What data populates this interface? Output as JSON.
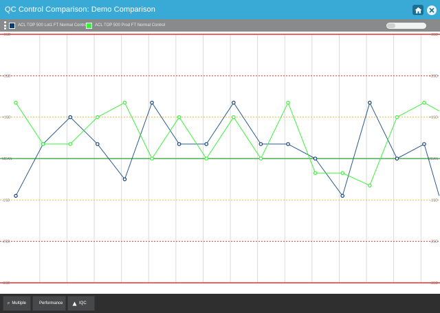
{
  "window": {
    "title": "QC Control Comparison: Demo Comparison",
    "home_icon": "home-icon",
    "close_icon": "close-icon"
  },
  "legend": {
    "items": [
      {
        "label": "ACL TOP 500 Lot1 FT Normal Control",
        "color": "#0d3b73"
      },
      {
        "label": "ACL TOP 500 Prod FT Normal Control",
        "color": "#3cf23c"
      }
    ],
    "toggle_icon": "toggle-switch-icon"
  },
  "chart_data": {
    "type": "line",
    "y_levels": [
      {
        "label": "+3SD",
        "value": 3,
        "color": "#e8322b",
        "style": "solid"
      },
      {
        "label": "+2SD",
        "value": 2,
        "color": "#e8322b",
        "style": "dotted"
      },
      {
        "label": "+1SD",
        "value": 1,
        "color": "#f0c040",
        "style": "dotted"
      },
      {
        "label": "MEAN",
        "value": 0,
        "color": "#4caf50",
        "style": "solid"
      },
      {
        "label": "-1SD",
        "value": -1,
        "color": "#f0c040",
        "style": "dotted"
      },
      {
        "label": "-2SD",
        "value": -2,
        "color": "#e8322b",
        "style": "dotted"
      },
      {
        "label": "-3SD",
        "value": -3,
        "color": "#e8322b",
        "style": "solid"
      }
    ],
    "ylim": [
      -3,
      3
    ],
    "x_count": 16,
    "grid_vertical": true,
    "series": [
      {
        "color": "#2b5b8f",
        "marker_color": "#12407a",
        "values": [
          -0.9,
          0.35,
          1.0,
          0.35,
          -0.5,
          1.35,
          0.35,
          0.35,
          1.35,
          0.35,
          0.35,
          0,
          -0.9,
          1.35,
          0,
          0.35,
          -0.9
        ],
        "x": [
          0,
          1,
          2,
          3,
          4,
          5,
          6,
          7,
          8,
          9,
          10,
          11,
          12,
          13,
          14,
          15,
          15.55
        ]
      },
      {
        "color": "#3cf23c",
        "marker_color": "#3cf23c",
        "values": [
          1.35,
          0.35,
          0.35,
          1.0,
          1.35,
          0,
          1.0,
          0,
          1.0,
          0,
          1.35,
          -0.35,
          -0.35,
          -0.65,
          1.0,
          1.35,
          1.15
        ],
        "x": [
          0,
          1,
          2,
          3,
          4,
          5,
          6,
          7,
          8,
          9,
          10,
          11,
          12,
          13,
          14,
          15,
          15.55
        ]
      }
    ]
  },
  "toolbar": {
    "buttons": [
      {
        "label": "Multiple",
        "icon": "flag-icon"
      },
      {
        "label": "Performance",
        "icon": "triangle-icon"
      },
      {
        "label": "IQC",
        "icon": "triangle-icon"
      }
    ]
  }
}
